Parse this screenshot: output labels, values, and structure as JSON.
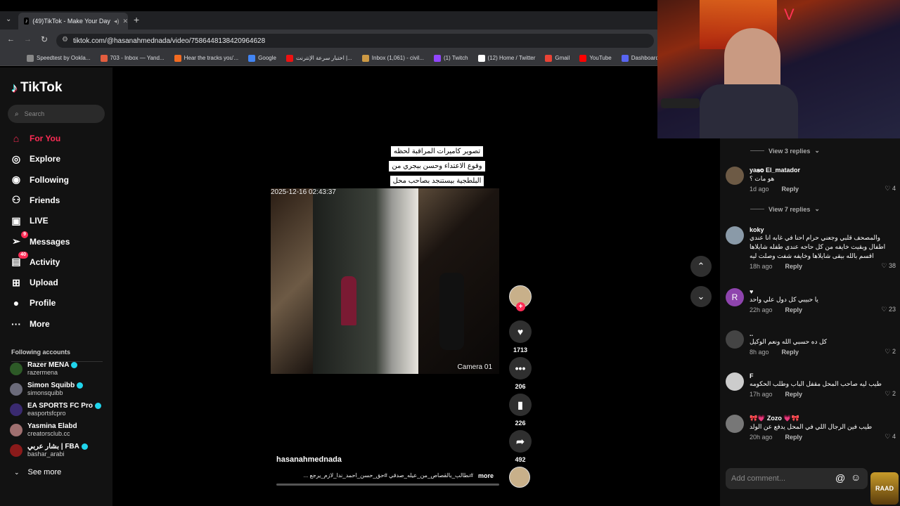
{
  "browser": {
    "tab_title": "(49)TikTok - Make Your Day",
    "url": "tiktok.com/@hasanahmednada/video/7586448138420964628",
    "bookmarks": [
      {
        "label": "Speedtest by Ookla...",
        "color": "#888"
      },
      {
        "label": "703 - Inbox — Yand...",
        "color": "#e25d3f"
      },
      {
        "label": "Hear the tracks you'...",
        "color": "#f36b21"
      },
      {
        "label": "Google",
        "color": "#4285f4"
      },
      {
        "label": "اختبار سرعة الإنترنت |...",
        "color": "#e11"
      },
      {
        "label": "Inbox (1,061) - civil...",
        "color": "#c94"
      },
      {
        "label": "(1) Twitch",
        "color": "#9146ff"
      },
      {
        "label": "(12) Home / Twitter",
        "color": "#fff"
      },
      {
        "label": "Gmail",
        "color": "#ea4335"
      },
      {
        "label": "YouTube",
        "color": "#f00"
      },
      {
        "label": "Dashboard - Rest",
        "color": "#5865f2"
      }
    ]
  },
  "sidebar": {
    "logo": "TikTok",
    "search_placeholder": "Search",
    "nav": [
      {
        "label": "For You",
        "icon": "home-icon",
        "glyph": "⌂",
        "active": true,
        "badge": ""
      },
      {
        "label": "Explore",
        "icon": "compass-icon",
        "glyph": "◎",
        "active": false,
        "badge": ""
      },
      {
        "label": "Following",
        "icon": "following-icon",
        "glyph": "◉",
        "active": false,
        "badge": ""
      },
      {
        "label": "Friends",
        "icon": "friends-icon",
        "glyph": "⚇",
        "active": false,
        "badge": ""
      },
      {
        "label": "LIVE",
        "icon": "live-icon",
        "glyph": "▣",
        "active": false,
        "badge": ""
      },
      {
        "label": "Messages",
        "icon": "messages-icon",
        "glyph": "➢",
        "active": false,
        "badge": "9"
      },
      {
        "label": "Activity",
        "icon": "activity-icon",
        "glyph": "▤",
        "active": false,
        "badge": "40"
      },
      {
        "label": "Upload",
        "icon": "upload-icon",
        "glyph": "⊞",
        "active": false,
        "badge": ""
      },
      {
        "label": "Profile",
        "icon": "profile-icon",
        "glyph": "●",
        "active": false,
        "badge": ""
      },
      {
        "label": "More",
        "icon": "more-icon",
        "glyph": "···",
        "active": false,
        "badge": ""
      }
    ],
    "following_title": "Following accounts",
    "accounts": [
      {
        "name": "Razer MENA",
        "handle": "razermena",
        "verified": true
      },
      {
        "name": "Simon Squibb",
        "handle": "simonsquibb",
        "verified": true
      },
      {
        "name": "EA SPORTS FC Pro",
        "handle": "easportsfcpro",
        "verified": true
      },
      {
        "name": "Yasmina Elabd",
        "handle": "creatorsclub.cc",
        "verified": false
      },
      {
        "name": "بشار عربي | FBA",
        "handle": "bashar_arabi",
        "verified": true
      }
    ],
    "see_more": "See more"
  },
  "video": {
    "caption_overlay": "تصوير كاميرات المراقبة لحظه وقوع الاعتداء وحسن بيجري من البلطجية بيستنجد بصاحب محل الملابس 💔💔",
    "timestamp": "2025-12-16 02:43:37",
    "camera_label": "Camera 01",
    "author": "hasanahmednada",
    "description": "#نطالب_بالقصاص_من_عيله_صدقي #حق_حسن_احمد_ندا_لازم_يرجع ...",
    "more_label": "more",
    "likes": "1713",
    "comments": "206",
    "saves": "226",
    "shares": "492"
  },
  "comments": {
    "items": [
      {
        "type": "replies",
        "label": "View 3 replies"
      },
      {
        "type": "comment",
        "name": "ya𝐬𝐨 El_matador",
        "text": "هو مات ؟",
        "time": "1d ago",
        "reply": "Reply",
        "likes": "4",
        "avatar": "#6d5a45"
      },
      {
        "type": "replies",
        "label": "View 7 replies"
      },
      {
        "type": "comment",
        "name": "koky",
        "text": "والمصحف قلبي وجعني حرام احنا في غابه انا عندي اطفال وبقيت خايفه من كل حاجه عندي طفله شايلاها اقسم بالله بيقى شايلاها وخايفه شفت وصلت ليه",
        "time": "18h ago",
        "reply": "Reply",
        "likes": "38",
        "avatar": "#8a9aa8"
      },
      {
        "type": "comment",
        "name": "♥",
        "text": "يا حبيبي كل دول علي واحد",
        "time": "22h ago",
        "reply": "Reply",
        "likes": "23",
        "avatar": "#8e44ad",
        "initial": "R"
      },
      {
        "type": "comment",
        "name": "..",
        "text": "كل ده حسبي الله ونعم الوكيل",
        "time": "8h ago",
        "reply": "Reply",
        "likes": "2",
        "avatar": "#444"
      },
      {
        "type": "comment",
        "name": "F",
        "text": "طيب ليه صاحب المحل مقفل الباب وطلب الحكومه",
        "time": "17h ago",
        "reply": "Reply",
        "likes": "2",
        "avatar": "#ccc"
      },
      {
        "type": "comment",
        "name": "🎀💗 Zozo 💗🎀",
        "text": "طيب فين الرجال اللي في المحل يدفع عن الولد",
        "time": "20h ago",
        "reply": "Reply",
        "likes": "4",
        "avatar": "#777"
      }
    ],
    "add_placeholder": "Add comment..."
  },
  "stream": {
    "logo_text": "RAAD"
  }
}
